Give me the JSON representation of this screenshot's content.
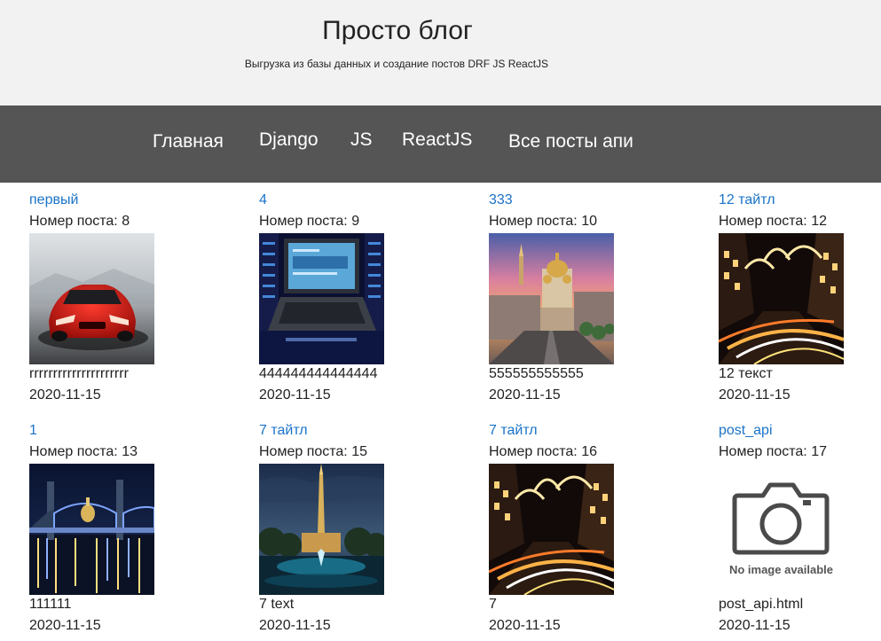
{
  "header": {
    "title": "Просто блог",
    "subtitle": "Выгрузка из базы данных и создание постов DRF JS ReactJS"
  },
  "nav": {
    "items": [
      {
        "label": "Главная"
      },
      {
        "label": "Django"
      },
      {
        "label": "JS"
      },
      {
        "label": "ReactJS"
      },
      {
        "label": "Все посты апи"
      }
    ]
  },
  "posts": [
    {
      "title": "первый",
      "number_label": "Номер поста: 8",
      "text": "rrrrrrrrrrrrrrrrrrrrr",
      "date": "2020-11-15",
      "image": "red-sports-car"
    },
    {
      "title": "4",
      "number_label": "Номер поста: 9",
      "text": "444444444444444",
      "date": "2020-11-15",
      "image": "server-rack-laptop"
    },
    {
      "title": "333",
      "number_label": "Номер поста: 10",
      "text": "555555555555",
      "date": "2020-11-15",
      "image": "city-cathedral-sunset"
    },
    {
      "title": "12 тайтл",
      "number_label": "Номер поста: 12",
      "text": "12 текст",
      "date": "2020-11-15",
      "image": "night-street-lights"
    },
    {
      "title": "1",
      "number_label": "Номер поста: 13",
      "text": "111111",
      "date": "2020-11-15",
      "image": "night-bridge"
    },
    {
      "title": "7 тайтл",
      "number_label": "Номер поста: 15",
      "text": "7 text",
      "date": "2020-11-15",
      "image": "spire-fountain-dusk"
    },
    {
      "title": "7 тайтл",
      "number_label": "Номер поста: 16",
      "text": "7",
      "date": "2020-11-15",
      "image": "night-street-lights"
    },
    {
      "title": "post_api",
      "number_label": "Номер поста: 17",
      "text": "post_api.html",
      "date": "2020-11-15",
      "image": "camera-icon",
      "image_placeholder_text": "No image available"
    }
  ],
  "colors": {
    "header_bg": "#f2f2f2",
    "nav_bg": "#555555",
    "link": "#1a73c8"
  }
}
